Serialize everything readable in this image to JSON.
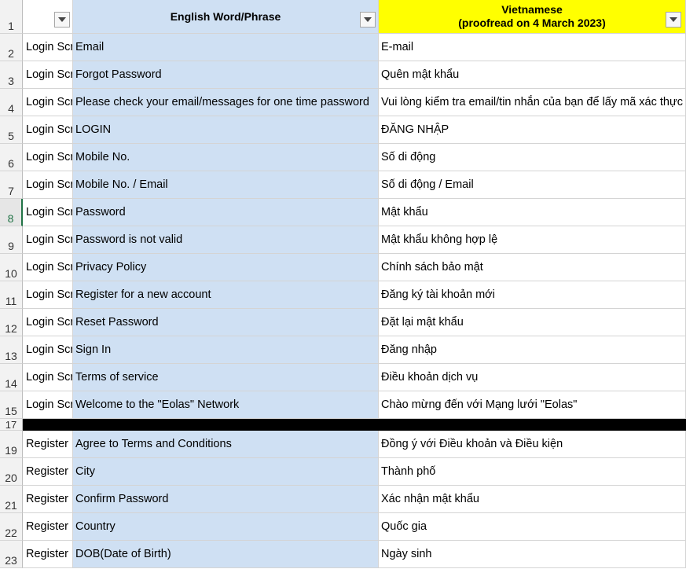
{
  "header": {
    "row_number": "1",
    "col_b_title": "English Word/Phrase",
    "col_c_title_line1": "Vietnamese",
    "col_c_title_line2": "(proofread on 4 March 2023)"
  },
  "colors": {
    "english_column_fill": "#cfe0f3",
    "vietnamese_header_fill": "#ffff00",
    "separator_row_fill": "#000000",
    "active_row_accent": "#217346"
  },
  "active_row": "8",
  "separator_row": {
    "row_number": "17"
  },
  "rows_top": [
    {
      "num": "2",
      "screen": "Login Scr",
      "en": "Email",
      "vi": "E-mail"
    },
    {
      "num": "3",
      "screen": "Login Scr",
      "en": "Forgot Password",
      "vi": "Quên mật khẩu"
    },
    {
      "num": "4",
      "screen": "Login Scr",
      "en": "Please check your email/messages for one time password",
      "vi": "Vui lòng kiểm tra email/tin nhắn của bạn để lấy mã xác thực"
    },
    {
      "num": "5",
      "screen": "Login Scr",
      "en": "LOGIN",
      "vi": "ĐĂNG NHẬP"
    },
    {
      "num": "6",
      "screen": "Login Scr",
      "en": "Mobile No.",
      "vi": "Số di động"
    },
    {
      "num": "7",
      "screen": "Login Scr",
      "en": "Mobile No. / Email",
      "vi": "Số di động / Email"
    },
    {
      "num": "8",
      "screen": "Login Scr",
      "en": "Password",
      "vi": "Mật khẩu"
    },
    {
      "num": "9",
      "screen": "Login Scr",
      "en": "Password is not valid",
      "vi": "Mật khẩu không hợp lệ"
    },
    {
      "num": "10",
      "screen": "Login Scr",
      "en": "Privacy Policy",
      "vi": "Chính sách bảo mật"
    },
    {
      "num": "11",
      "screen": "Login Scr",
      "en": "Register for a new account",
      "vi": "Đăng ký tài khoản mới"
    },
    {
      "num": "12",
      "screen": "Login Scr",
      "en": "Reset Password",
      "vi": "Đặt lại mật khẩu"
    },
    {
      "num": "13",
      "screen": "Login Scr",
      "en": "Sign In",
      "vi": "Đăng nhập"
    },
    {
      "num": "14",
      "screen": "Login Scr",
      "en": "Terms of service",
      "vi": "Điều khoản dịch vụ"
    },
    {
      "num": "15",
      "screen": "Login Scr",
      "en": "Welcome to the \"Eolas\" Network",
      "vi": "Chào mừng đến với Mạng lưới \"Eolas\""
    }
  ],
  "rows_bottom": [
    {
      "num": "19",
      "screen": "Register",
      "en": "Agree to Terms and Conditions",
      "vi": "Đồng ý với Điều khoản và Điều kiện"
    },
    {
      "num": "20",
      "screen": "Register",
      "en": "City",
      "vi": "Thành phố"
    },
    {
      "num": "21",
      "screen": "Register",
      "en": "Confirm Password",
      "vi": "Xác nhận mật khẩu"
    },
    {
      "num": "22",
      "screen": "Register",
      "en": "Country",
      "vi": "Quốc gia"
    },
    {
      "num": "23",
      "screen": "Register",
      "en": "DOB(Date of Birth)",
      "vi": "Ngày sinh"
    }
  ]
}
